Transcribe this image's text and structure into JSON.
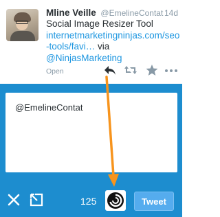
{
  "tweet": {
    "author_name": "Mline Veille",
    "handle": "@EmelineContat",
    "time": "14d",
    "text_main": "Social Image Resizer Tool",
    "link_part1": "internetmarketingninjas.com/seo",
    "link_part2": "-tools/favi…",
    "via_word": "via",
    "mention": "@NinjasMarketing",
    "open_label": "Open",
    "icons": [
      "reply-icon",
      "retweet-icon",
      "favorite-star-icon",
      "more-icon"
    ]
  },
  "compose": {
    "text": "@EmelineContat",
    "char_count": "125",
    "tweet_button": "Tweet",
    "icons": [
      "close-icon",
      "popout-icon",
      "image-resizer-logo-icon"
    ]
  },
  "annotation": {
    "arrow_color": "#f7941d"
  },
  "colors": {
    "panel_blue": "#1d8dcf",
    "link_blue": "#1b95e0",
    "tweet_button": "#55acee"
  }
}
